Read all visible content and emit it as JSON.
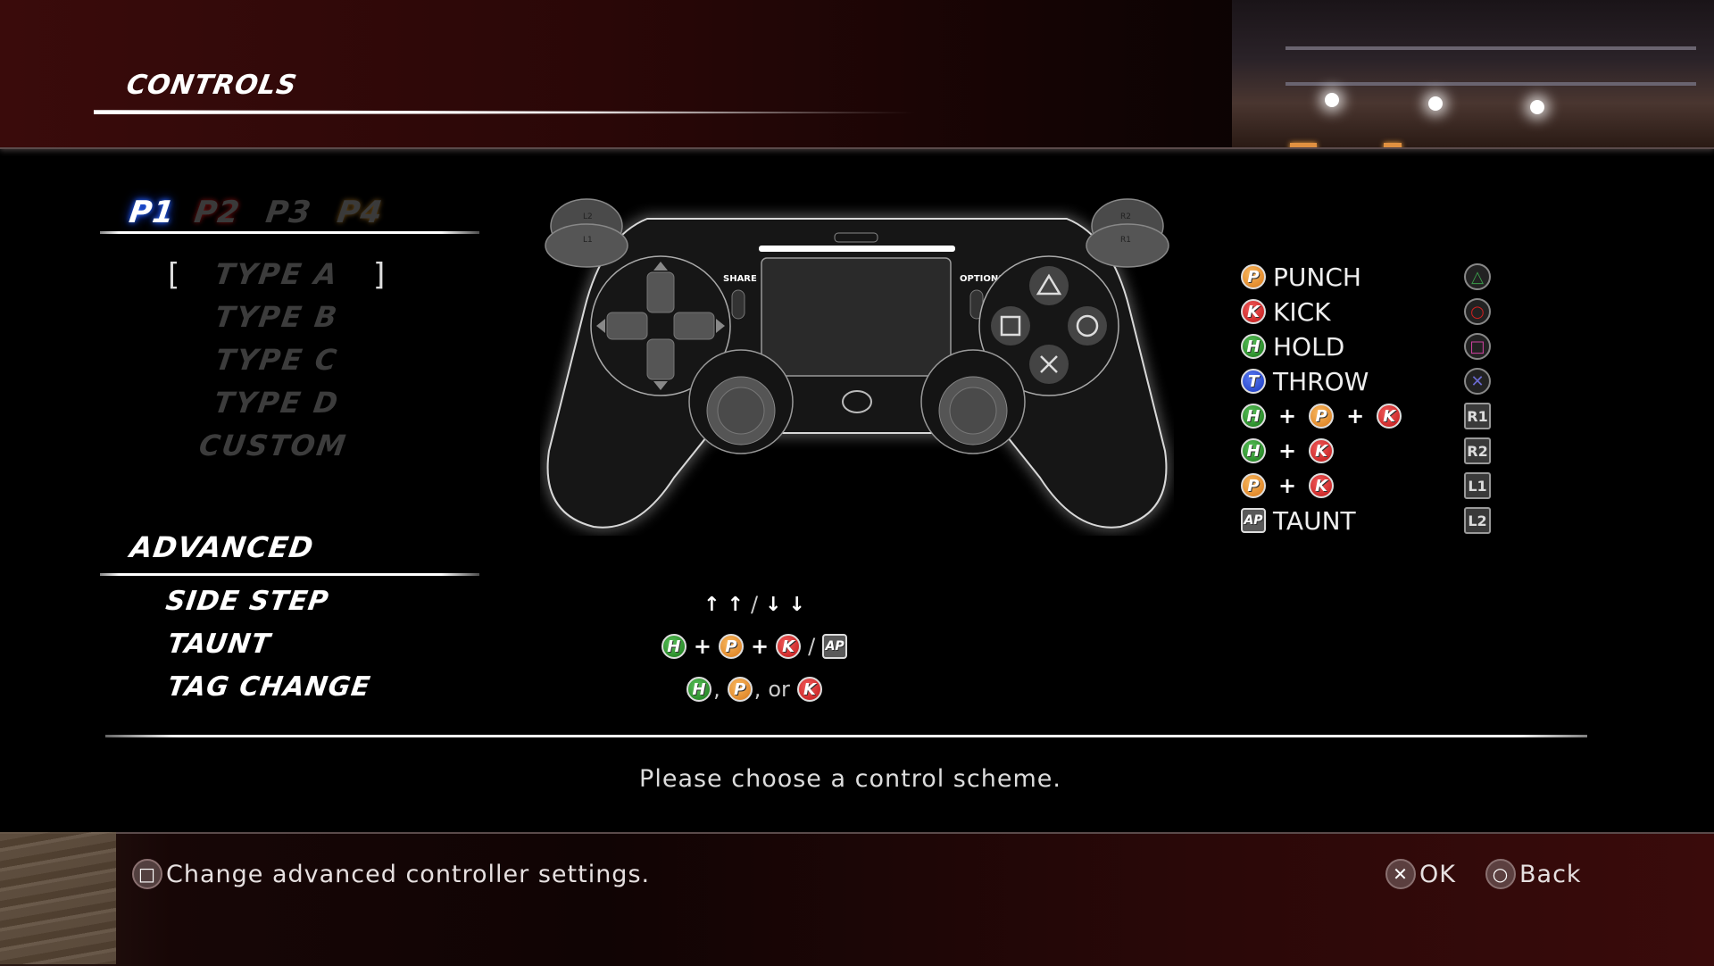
{
  "header": {
    "title": "CONTROLS"
  },
  "player_tabs": [
    {
      "label": "P1",
      "selected": true,
      "color": "#2a6aff"
    },
    {
      "label": "P2",
      "selected": false,
      "color": "#7a1010"
    },
    {
      "label": "P3",
      "selected": false,
      "color": "#3a3a3a"
    },
    {
      "label": "P4",
      "selected": false,
      "color": "#6a4a18"
    }
  ],
  "control_types": {
    "selected": "TYPE A",
    "bracket_left": "[",
    "bracket_right": "]",
    "items": [
      {
        "label": "TYPE A"
      },
      {
        "label": "TYPE B"
      },
      {
        "label": "TYPE C"
      },
      {
        "label": "TYPE D"
      },
      {
        "label": "CUSTOM"
      }
    ]
  },
  "controller": {
    "labels": {
      "l2": "L2",
      "l1": "L1",
      "r2": "R2",
      "r1": "R1",
      "share": "SHARE",
      "options": "OPTIONS"
    }
  },
  "legend": {
    "rows": [
      {
        "badges": [
          "P"
        ],
        "text": "PUNCH",
        "button": "triangle",
        "button_label": "△",
        "button_color": "#3a9a4a"
      },
      {
        "badges": [
          "K"
        ],
        "text": "KICK",
        "button": "circle",
        "button_label": "○",
        "button_color": "#d02020"
      },
      {
        "badges": [
          "H"
        ],
        "text": "HOLD",
        "button": "square",
        "button_label": "□",
        "button_color": "#d040a0"
      },
      {
        "badges": [
          "T"
        ],
        "text": "THROW",
        "button": "cross",
        "button_label": "✕",
        "button_color": "#6a6ad0"
      },
      {
        "badges": [
          "H",
          "P",
          "K"
        ],
        "text": "",
        "button": "r1",
        "button_label": "R1"
      },
      {
        "badges": [
          "H",
          "K"
        ],
        "text": "",
        "button": "r2",
        "button_label": "R2"
      },
      {
        "badges": [
          "P",
          "K"
        ],
        "text": "",
        "button": "l1",
        "button_label": "L1"
      },
      {
        "badges": [
          "AP"
        ],
        "text": "TAUNT",
        "button": "l2",
        "button_label": "L2"
      }
    ],
    "plus": "+"
  },
  "advanced": {
    "title": "ADVANCED",
    "items": [
      {
        "label": "SIDE STEP",
        "value_text": "↑ ↑ / ↓ ↓"
      },
      {
        "label": "TAUNT",
        "value_text": "H + P + K / AP"
      },
      {
        "label": "TAG CHANGE",
        "value_text": "H, P, or K"
      }
    ],
    "side_step": {
      "up": "↑",
      "down": "↓",
      "sep": "/"
    },
    "taunt": {
      "plus": "+",
      "sep": "/"
    },
    "tag_change": {
      "comma": ",",
      "or": "or"
    }
  },
  "badges": {
    "P": {
      "letter": "P",
      "color": "#e8901e"
    },
    "K": {
      "letter": "K",
      "color": "#d62828"
    },
    "H": {
      "letter": "H",
      "color": "#2e962e"
    },
    "T": {
      "letter": "T",
      "color": "#2848d8"
    },
    "AP": {
      "letter": "AP",
      "color": "#5a5a5a"
    }
  },
  "message": "Please choose a control scheme.",
  "footer": {
    "hint_left": {
      "icon": "square-button-icon",
      "glyph": "□",
      "label": "Change advanced controller settings."
    },
    "ok": {
      "icon": "cross-button-icon",
      "glyph": "✕",
      "label": "OK"
    },
    "back": {
      "icon": "circle-button-icon",
      "glyph": "○",
      "label": "Back"
    }
  }
}
